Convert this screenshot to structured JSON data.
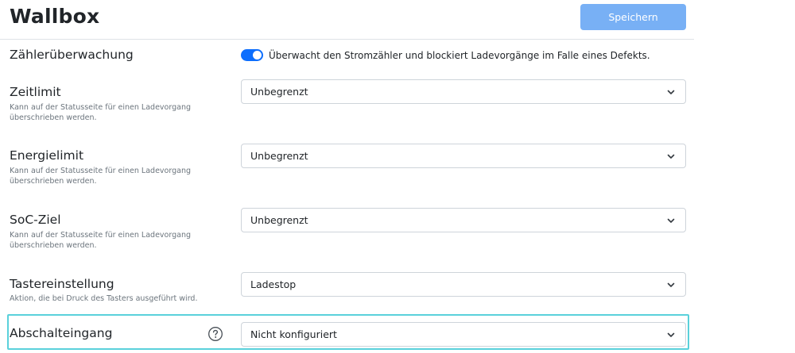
{
  "header": {
    "title": "Wallbox",
    "save_label": "Speichern"
  },
  "meter_monitoring": {
    "label": "Zählerüberwachung",
    "toggle_on": true,
    "toggle_text": "Überwacht den Stromzähler und blockiert Ladevorgänge im Falle eines Defekts."
  },
  "time_limit": {
    "label": "Zeitlimit",
    "help": "Kann auf der Statusseite für einen Ladevorgang überschrieben werden.",
    "value": "Unbegrenzt"
  },
  "energy_limit": {
    "label": "Energielimit",
    "help": "Kann auf der Statusseite für einen Ladevorgang überschrieben werden.",
    "value": "Unbegrenzt"
  },
  "soc_target": {
    "label": "SoC-Ziel",
    "help": "Kann auf der Statusseite für einen Ladevorgang überschrieben werden.",
    "value": "Unbegrenzt"
  },
  "button_setting": {
    "label": "Tastereinstellung",
    "help": "Aktion, die bei Druck des Tasters ausgeführt wird.",
    "value": "Ladestop"
  },
  "shutdown_input": {
    "label": "Abschalteingang",
    "value": "Nicht konfiguriert"
  },
  "colors": {
    "accent": "#0d6efd",
    "save_button": "#78b0f5",
    "highlight": "#5ad1db"
  },
  "icons": [
    "chevron-down-icon",
    "question-circle-icon"
  ]
}
